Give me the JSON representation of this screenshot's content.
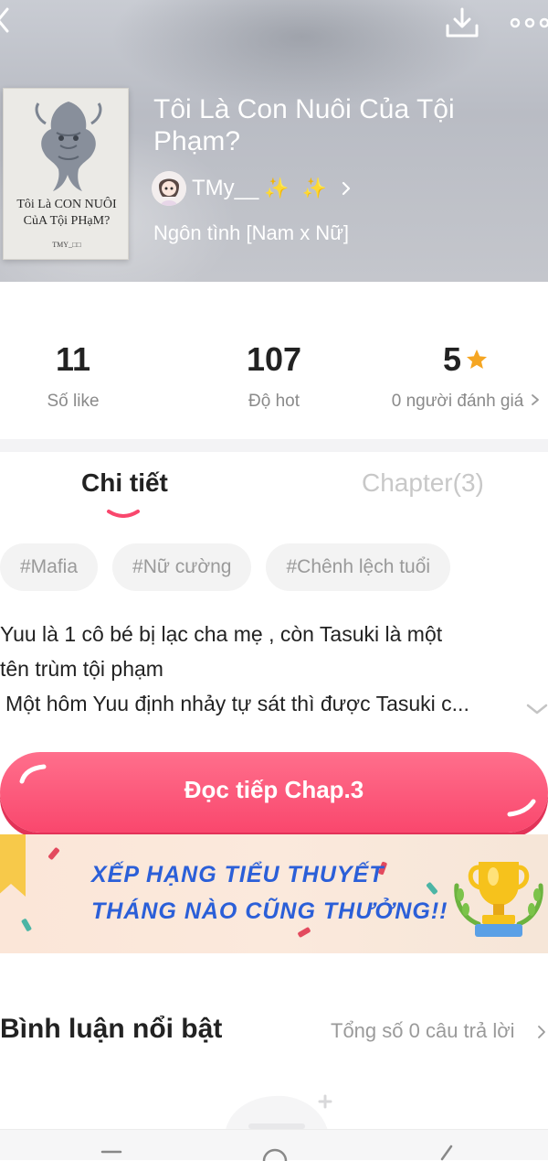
{
  "book": {
    "title": "Tôi Là Con Nuôi Của Tội Phạm?",
    "author": "TMy__",
    "author_sparkles": "✨ ✨",
    "genre": "Ngôn tình [Nam x Nữ]",
    "cover": {
      "title_line1": "Tôi Là CON NUÔI",
      "title_line2": "CủA Tội PHạM?",
      "author": "TMY_□□"
    }
  },
  "stats": {
    "likes": {
      "value": "11",
      "label": "Số like"
    },
    "hot": {
      "value": "107",
      "label": "Độ hot"
    },
    "rating": {
      "value": "5",
      "label": "0 người đánh giá"
    }
  },
  "tabs": [
    {
      "label": "Chi tiết",
      "active": true
    },
    {
      "label": "Chapter(3)",
      "active": false
    }
  ],
  "tags": [
    "#Mafia",
    "#Nữ cường",
    "#Chênh lệch tuổi"
  ],
  "description": {
    "line1": "Yuu là 1 cô bé bị lạc cha mẹ , còn Tasuki là một",
    "line2": "tên trùm tội phạm",
    "line3": "Một hôm Yuu định nhảy tự sát thì được Tasuki c..."
  },
  "read_button": {
    "label": "Đọc tiếp Chap.3"
  },
  "banner": {
    "line1": "XẾP HẠNG TIỂU THUYẾT",
    "line2": "THÁNG NÀO CŨNG THƯỞNG!!"
  },
  "comments": {
    "title": "Bình luận nổi bật",
    "count_label": "Tổng số 0 câu trả lời"
  },
  "colors": {
    "accent": "#f9476d",
    "star": "#f5a623",
    "banner_text": "#2b5fd8"
  }
}
